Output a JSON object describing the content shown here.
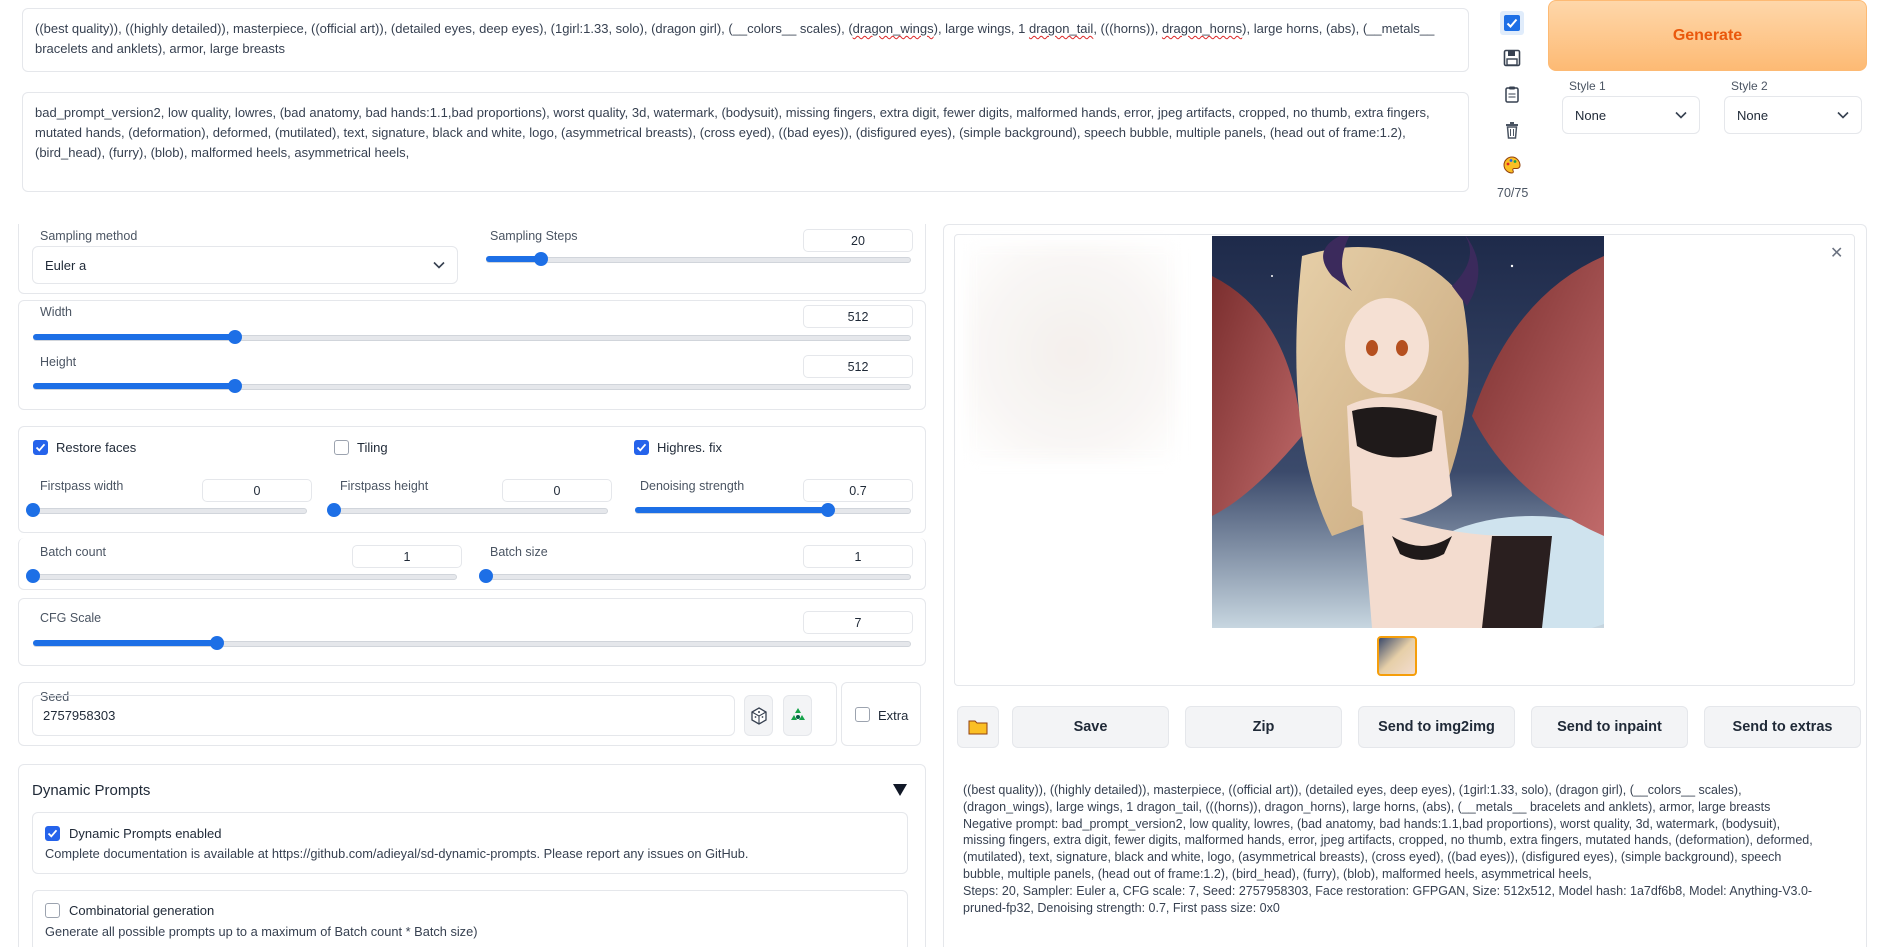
{
  "prompt": {
    "seg1": "((best quality)), ((highly detailed)), masterpiece, ((official art)), (detailed eyes, deep eyes), (1girl:1.33, solo), (dragon girl), (__colors__ scales), (",
    "sp1": "dragon_wings",
    "seg2": "), large wings, 1 ",
    "sp2": "dragon_tail",
    "seg3": ", (((horns)), ",
    "sp3": "dragon_horns",
    "seg4": "), large horns, (abs), (__metals__ bracelets and anklets), armor, large breasts"
  },
  "negative_prompt": "bad_prompt_version2, low quality, lowres, (bad anatomy, bad hands:1.1,bad proportions), worst quality, 3d, watermark, (bodysuit), missing fingers, extra digit, fewer digits, malformed hands, error, jpeg artifacts, cropped, no thumb, extra fingers, mutated hands, (deformation), deformed, (mutilated), text, signature, black and white, logo, (asymmetrical breasts), (cross eyed), ((bad eyes)), (disfigured eyes), (simple background), speech bubble, multiple panels, (head out of frame:1.2), (bird_head), (furry), (blob), malformed heels, asymmetrical heels,",
  "token_count": "70/75",
  "generate_label": "Generate",
  "style1": {
    "label": "Style 1",
    "value": "None"
  },
  "style2": {
    "label": "Style 2",
    "value": "None"
  },
  "sampling": {
    "method_label": "Sampling method",
    "method_value": "Euler a",
    "steps_label": "Sampling Steps",
    "steps_value": "20",
    "steps_fraction": 0.13
  },
  "width": {
    "label": "Width",
    "value": "512",
    "fraction": 0.23
  },
  "height": {
    "label": "Height",
    "value": "512",
    "fraction": 0.23
  },
  "checks": {
    "restore_faces": "Restore faces",
    "tiling": "Tiling",
    "highres": "Highres. fix"
  },
  "firstpass_width": {
    "label": "Firstpass width",
    "value": "0"
  },
  "firstpass_height": {
    "label": "Firstpass height",
    "value": "0"
  },
  "denoising": {
    "label": "Denoising strength",
    "value": "0.7",
    "fraction": 0.7
  },
  "batch_count": {
    "label": "Batch count",
    "value": "1"
  },
  "batch_size": {
    "label": "Batch size",
    "value": "1"
  },
  "cfg": {
    "label": "CFG Scale",
    "value": "7",
    "fraction": 0.21
  },
  "seed": {
    "label": "Seed",
    "value": "2757958303",
    "extra_label": "Extra"
  },
  "dynamic": {
    "title": "Dynamic Prompts",
    "enabled_label": "Dynamic Prompts enabled",
    "enabled_desc": "Complete documentation is available at https://github.com/adieyal/sd-dynamic-prompts. Please report any issues on GitHub.",
    "combinatorial_label": "Combinatorial generation",
    "combinatorial_desc": "Generate all possible prompts up to a maximum of Batch count * Batch size)"
  },
  "actions": {
    "save": "Save",
    "zip": "Zip",
    "img2img": "Send to img2img",
    "inpaint": "Send to inpaint",
    "extras": "Send to extras"
  },
  "info": {
    "line1": "((best quality)), ((highly detailed)), masterpiece, ((official art)), (detailed eyes, deep eyes), (1girl:1.33, solo), (dragon girl), (__colors__ scales),",
    "line2": "(dragon_wings), large wings, 1 dragon_tail, (((horns)), dragon_horns), large horns, (abs), (__metals__ bracelets and anklets), armor, large breasts",
    "negative": "Negative prompt: bad_prompt_version2, low quality, lowres, (bad anatomy, bad hands:1.1,bad proportions), worst quality, 3d, watermark, (bodysuit), missing fingers, extra digit, fewer digits, malformed hands, error, jpeg artifacts, cropped, no thumb, extra fingers, mutated hands, (deformation), deformed, (mutilated), text, signature, black and white, logo, (asymmetrical breasts), (cross eyed), ((bad eyes)), (disfigured eyes), (simple background), speech bubble, multiple panels, (head out of frame:1.2), (bird_head), (furry), (blob), malformed heels, asymmetrical heels,",
    "params": "Steps: 20, Sampler: Euler a, CFG scale: 7, Seed: 2757958303, Face restoration: GFPGAN, Size: 512x512, Model hash: 1a7df6b8, Model: Anything-V3.0-pruned-fp32, Denoising strength: 0.7, First pass size: 0x0"
  },
  "colors": {
    "accent": "#1d6fe6",
    "generate": "#ea580c",
    "generate_bg": "#fdba74"
  }
}
